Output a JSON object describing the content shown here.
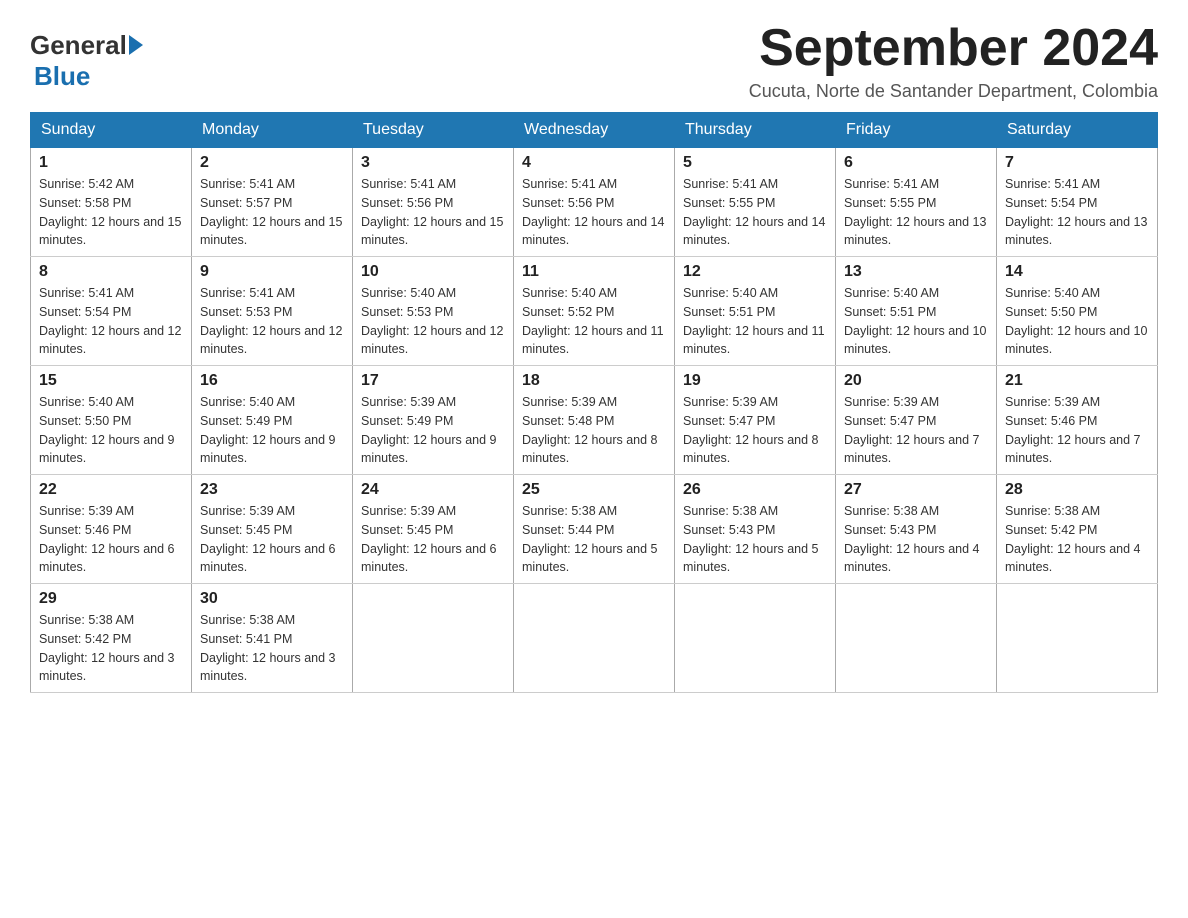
{
  "header": {
    "logo_general": "General",
    "logo_blue": "Blue",
    "month_title": "September 2024",
    "location": "Cucuta, Norte de Santander Department, Colombia"
  },
  "days_of_week": [
    "Sunday",
    "Monday",
    "Tuesday",
    "Wednesday",
    "Thursday",
    "Friday",
    "Saturday"
  ],
  "weeks": [
    [
      {
        "day": "1",
        "sunrise": "Sunrise: 5:42 AM",
        "sunset": "Sunset: 5:58 PM",
        "daylight": "Daylight: 12 hours and 15 minutes."
      },
      {
        "day": "2",
        "sunrise": "Sunrise: 5:41 AM",
        "sunset": "Sunset: 5:57 PM",
        "daylight": "Daylight: 12 hours and 15 minutes."
      },
      {
        "day": "3",
        "sunrise": "Sunrise: 5:41 AM",
        "sunset": "Sunset: 5:56 PM",
        "daylight": "Daylight: 12 hours and 15 minutes."
      },
      {
        "day": "4",
        "sunrise": "Sunrise: 5:41 AM",
        "sunset": "Sunset: 5:56 PM",
        "daylight": "Daylight: 12 hours and 14 minutes."
      },
      {
        "day": "5",
        "sunrise": "Sunrise: 5:41 AM",
        "sunset": "Sunset: 5:55 PM",
        "daylight": "Daylight: 12 hours and 14 minutes."
      },
      {
        "day": "6",
        "sunrise": "Sunrise: 5:41 AM",
        "sunset": "Sunset: 5:55 PM",
        "daylight": "Daylight: 12 hours and 13 minutes."
      },
      {
        "day": "7",
        "sunrise": "Sunrise: 5:41 AM",
        "sunset": "Sunset: 5:54 PM",
        "daylight": "Daylight: 12 hours and 13 minutes."
      }
    ],
    [
      {
        "day": "8",
        "sunrise": "Sunrise: 5:41 AM",
        "sunset": "Sunset: 5:54 PM",
        "daylight": "Daylight: 12 hours and 12 minutes."
      },
      {
        "day": "9",
        "sunrise": "Sunrise: 5:41 AM",
        "sunset": "Sunset: 5:53 PM",
        "daylight": "Daylight: 12 hours and 12 minutes."
      },
      {
        "day": "10",
        "sunrise": "Sunrise: 5:40 AM",
        "sunset": "Sunset: 5:53 PM",
        "daylight": "Daylight: 12 hours and 12 minutes."
      },
      {
        "day": "11",
        "sunrise": "Sunrise: 5:40 AM",
        "sunset": "Sunset: 5:52 PM",
        "daylight": "Daylight: 12 hours and 11 minutes."
      },
      {
        "day": "12",
        "sunrise": "Sunrise: 5:40 AM",
        "sunset": "Sunset: 5:51 PM",
        "daylight": "Daylight: 12 hours and 11 minutes."
      },
      {
        "day": "13",
        "sunrise": "Sunrise: 5:40 AM",
        "sunset": "Sunset: 5:51 PM",
        "daylight": "Daylight: 12 hours and 10 minutes."
      },
      {
        "day": "14",
        "sunrise": "Sunrise: 5:40 AM",
        "sunset": "Sunset: 5:50 PM",
        "daylight": "Daylight: 12 hours and 10 minutes."
      }
    ],
    [
      {
        "day": "15",
        "sunrise": "Sunrise: 5:40 AM",
        "sunset": "Sunset: 5:50 PM",
        "daylight": "Daylight: 12 hours and 9 minutes."
      },
      {
        "day": "16",
        "sunrise": "Sunrise: 5:40 AM",
        "sunset": "Sunset: 5:49 PM",
        "daylight": "Daylight: 12 hours and 9 minutes."
      },
      {
        "day": "17",
        "sunrise": "Sunrise: 5:39 AM",
        "sunset": "Sunset: 5:49 PM",
        "daylight": "Daylight: 12 hours and 9 minutes."
      },
      {
        "day": "18",
        "sunrise": "Sunrise: 5:39 AM",
        "sunset": "Sunset: 5:48 PM",
        "daylight": "Daylight: 12 hours and 8 minutes."
      },
      {
        "day": "19",
        "sunrise": "Sunrise: 5:39 AM",
        "sunset": "Sunset: 5:47 PM",
        "daylight": "Daylight: 12 hours and 8 minutes."
      },
      {
        "day": "20",
        "sunrise": "Sunrise: 5:39 AM",
        "sunset": "Sunset: 5:47 PM",
        "daylight": "Daylight: 12 hours and 7 minutes."
      },
      {
        "day": "21",
        "sunrise": "Sunrise: 5:39 AM",
        "sunset": "Sunset: 5:46 PM",
        "daylight": "Daylight: 12 hours and 7 minutes."
      }
    ],
    [
      {
        "day": "22",
        "sunrise": "Sunrise: 5:39 AM",
        "sunset": "Sunset: 5:46 PM",
        "daylight": "Daylight: 12 hours and 6 minutes."
      },
      {
        "day": "23",
        "sunrise": "Sunrise: 5:39 AM",
        "sunset": "Sunset: 5:45 PM",
        "daylight": "Daylight: 12 hours and 6 minutes."
      },
      {
        "day": "24",
        "sunrise": "Sunrise: 5:39 AM",
        "sunset": "Sunset: 5:45 PM",
        "daylight": "Daylight: 12 hours and 6 minutes."
      },
      {
        "day": "25",
        "sunrise": "Sunrise: 5:38 AM",
        "sunset": "Sunset: 5:44 PM",
        "daylight": "Daylight: 12 hours and 5 minutes."
      },
      {
        "day": "26",
        "sunrise": "Sunrise: 5:38 AM",
        "sunset": "Sunset: 5:43 PM",
        "daylight": "Daylight: 12 hours and 5 minutes."
      },
      {
        "day": "27",
        "sunrise": "Sunrise: 5:38 AM",
        "sunset": "Sunset: 5:43 PM",
        "daylight": "Daylight: 12 hours and 4 minutes."
      },
      {
        "day": "28",
        "sunrise": "Sunrise: 5:38 AM",
        "sunset": "Sunset: 5:42 PM",
        "daylight": "Daylight: 12 hours and 4 minutes."
      }
    ],
    [
      {
        "day": "29",
        "sunrise": "Sunrise: 5:38 AM",
        "sunset": "Sunset: 5:42 PM",
        "daylight": "Daylight: 12 hours and 3 minutes."
      },
      {
        "day": "30",
        "sunrise": "Sunrise: 5:38 AM",
        "sunset": "Sunset: 5:41 PM",
        "daylight": "Daylight: 12 hours and 3 minutes."
      },
      null,
      null,
      null,
      null,
      null
    ]
  ]
}
